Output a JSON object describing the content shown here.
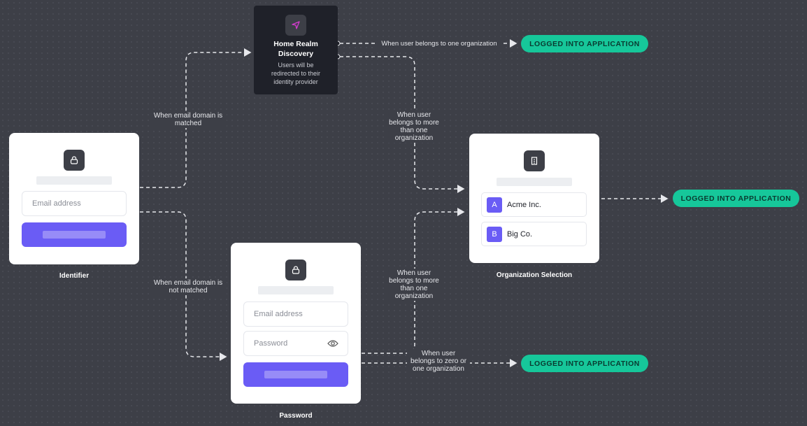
{
  "hrd": {
    "title": "Home Realm Discovery",
    "desc": "Users will be redirected to their identity provider",
    "icon": "navigation-arrow-icon"
  },
  "identifier": {
    "label": "Identifier",
    "email_placeholder": "Email address",
    "icon": "lock-icon"
  },
  "password": {
    "label": "Password",
    "email_placeholder": "Email address",
    "password_placeholder": "Password",
    "icon": "lock-icon"
  },
  "org_selection": {
    "label": "Organization Selection",
    "icon": "building-icon",
    "orgs": [
      {
        "badge": "A",
        "name": "Acme Inc."
      },
      {
        "badge": "B",
        "name": "Big Co."
      }
    ]
  },
  "edges": {
    "matched": "When email domain is matched",
    "not_matched": "When email domain is not matched",
    "one_org": "When user belongs to one organization",
    "more_than_one_1": "When user belongs to more than one organization",
    "more_than_one_2": "When user belongs to more than one organization",
    "zero_or_one": "When user belongs to zero or one organization"
  },
  "outcomes": [
    "LOGGED INTO APPLICATION",
    "LOGGED INTO APPLICATION",
    "LOGGED INTO APPLICATION"
  ],
  "colors": {
    "accent": "#6a5cf5",
    "success": "#16c79a",
    "background": "#3d3f47"
  }
}
